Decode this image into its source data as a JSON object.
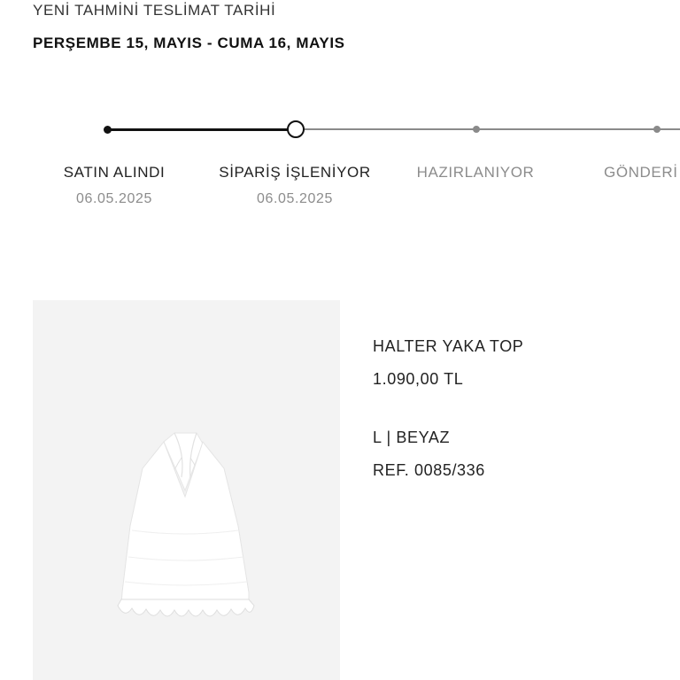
{
  "delivery": {
    "label": "YENİ TAHMİNİ TESLİMAT TARİHİ",
    "range": "PERŞEMBE 15, MAYIS - CUMA 16, MAYIS"
  },
  "tracker": {
    "steps": [
      {
        "label": "SATIN ALINDI",
        "date": "06.05.2025",
        "status": "done"
      },
      {
        "label": "SİPARİŞ İŞLENİYOR",
        "date": "06.05.2025",
        "status": "current"
      },
      {
        "label": "HAZIRLANIYOR",
        "date": "",
        "status": "pending"
      },
      {
        "label": "GÖNDERİ",
        "date": "",
        "status": "pending"
      }
    ],
    "colors": {
      "done": "#111111",
      "pending": "#8a8a8a"
    }
  },
  "product": {
    "name": "HALTER YAKA TOP",
    "price": "1.090,00 TL",
    "variant": "L | BEYAZ",
    "reference": "REF. 0085/336",
    "image_background": "#f3f3f3"
  }
}
